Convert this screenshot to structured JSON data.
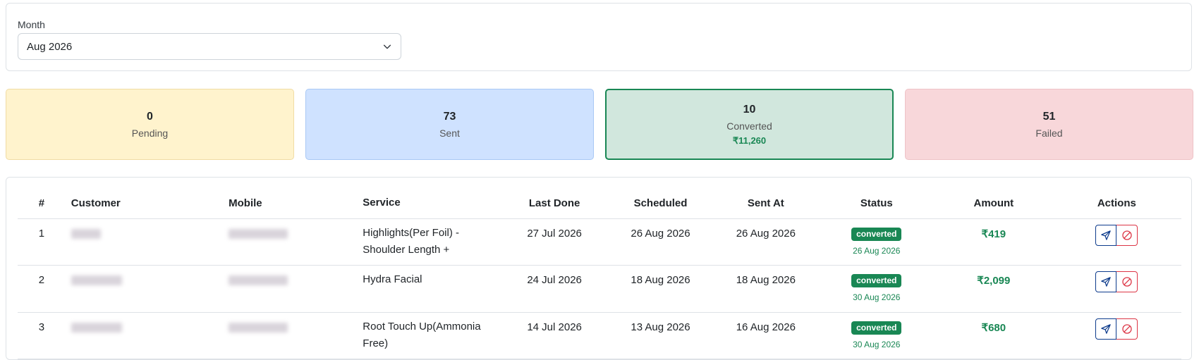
{
  "filter": {
    "label": "Month",
    "selected": "Aug 2026"
  },
  "stats": {
    "pending": {
      "value": "0",
      "label": "Pending"
    },
    "sent": {
      "value": "73",
      "label": "Sent"
    },
    "converted": {
      "value": "10",
      "label": "Converted",
      "amount": "₹11,260"
    },
    "failed": {
      "value": "51",
      "label": "Failed"
    }
  },
  "table": {
    "headers": [
      "#",
      "Customer",
      "Mobile",
      "Service",
      "Last Done",
      "Scheduled",
      "Sent At",
      "Status",
      "Amount",
      "Actions"
    ],
    "rows": [
      {
        "index": "1",
        "service": "Highlights(Per Foil) - Shoulder Length +",
        "last_done": "27 Jul 2026",
        "scheduled": "26 Aug 2026",
        "sent_at": "26 Aug 2026",
        "status": "converted",
        "status_date": "26 Aug 2026",
        "amount": "₹419"
      },
      {
        "index": "2",
        "service": "Hydra Facial",
        "last_done": "24 Jul 2026",
        "scheduled": "18 Aug 2026",
        "sent_at": "18 Aug 2026",
        "status": "converted",
        "status_date": "30 Aug 2026",
        "amount": "₹2,099"
      },
      {
        "index": "3",
        "service": "Root Touch Up(Ammonia Free)",
        "last_done": "14 Jul 2026",
        "scheduled": "13 Aug 2026",
        "sent_at": "16 Aug 2026",
        "status": "converted",
        "status_date": "30 Aug 2026",
        "amount": "₹680"
      }
    ]
  },
  "icons": {
    "select": "chevron-down-icon",
    "send": "send-icon",
    "block": "block-icon"
  },
  "colors": {
    "success": "#198754",
    "primary_outline": "#0d3b8c",
    "danger": "#dc3545"
  }
}
